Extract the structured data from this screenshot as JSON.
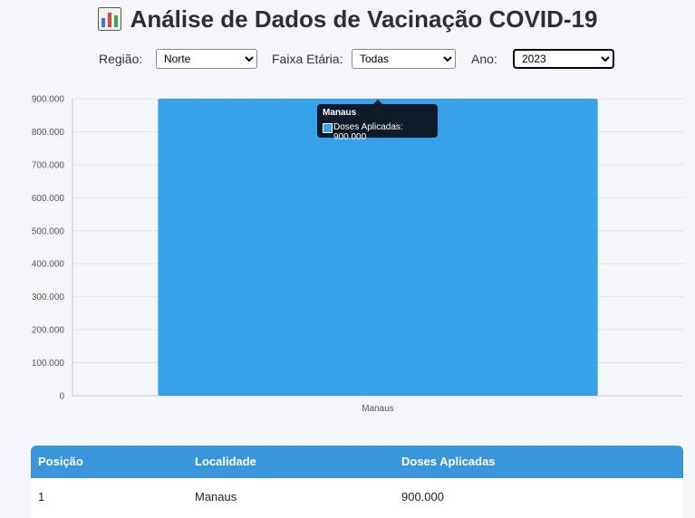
{
  "header": {
    "title": "Análise de Dados de Vacinação COVID-19",
    "icon": "bar-chart-icon"
  },
  "filters": {
    "regiao": {
      "label": "Região:",
      "value": "Norte"
    },
    "faixa_etaria": {
      "label": "Faixa Etária:",
      "value": "Todas"
    },
    "ano": {
      "label": "Ano:",
      "value": "2023"
    }
  },
  "tooltip": {
    "title": "Manaus",
    "line": "Doses Aplicadas: 900.000"
  },
  "chart_data": {
    "type": "bar",
    "categories": [
      "Manaus"
    ],
    "series": [
      {
        "name": "Doses Aplicadas",
        "values": [
          900000
        ],
        "color": "#36a2eb"
      }
    ],
    "ylim": [
      0,
      900000
    ],
    "y_ticks": [
      "0",
      "100.000",
      "200.000",
      "300.000",
      "400.000",
      "500.000",
      "600.000",
      "700.000",
      "800.000",
      "900.000"
    ],
    "grid": true
  },
  "table": {
    "headers": [
      "Posição",
      "Localidade",
      "Doses Aplicadas"
    ],
    "rows": [
      [
        "1",
        "Manaus",
        "900.000"
      ]
    ]
  }
}
